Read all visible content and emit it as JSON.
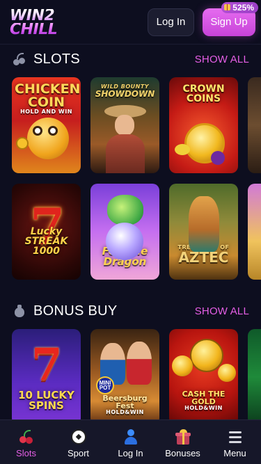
{
  "header": {
    "logo_line1": "WIN2",
    "logo_line2": "CHILL",
    "login_label": "Log In",
    "signup_label": "Sign Up",
    "bonus_badge": "525%"
  },
  "sections": [
    {
      "title": "SLOTS",
      "icon": "cherry-icon",
      "show_all": "SHOW ALL",
      "rows": [
        [
          {
            "title": "CHICKEN COIN",
            "subtitle": "HOLD AND WIN"
          },
          {
            "title": "SHOWDOWN",
            "subtitle": "WILD BOUNTY"
          },
          {
            "title": "CROWN COINS",
            "subtitle": ""
          }
        ],
        [
          {
            "title": "Lucky STREAK 1000",
            "subtitle": ""
          },
          {
            "title": "Fortune Dragon",
            "subtitle": ""
          },
          {
            "title": "AZTEC",
            "subtitle": "TREASURES OF"
          }
        ]
      ]
    },
    {
      "title": "BONUS BUY",
      "icon": "money-bag-icon",
      "show_all": "SHOW ALL",
      "rows": [
        [
          {
            "title": "10 LUCKY SPINS",
            "subtitle": ""
          },
          {
            "title": "Beersburg Fest",
            "subtitle": "HOLD&WIN",
            "badge": "MINI POT"
          },
          {
            "title": "CASH THE GOLD",
            "subtitle": "HOLD&WIN"
          }
        ]
      ]
    }
  ],
  "bottom_nav": [
    {
      "label": "Slots",
      "icon": "cherry-icon",
      "active": true
    },
    {
      "label": "Sport",
      "icon": "soccer-ball-icon",
      "active": false
    },
    {
      "label": "Log In",
      "icon": "user-icon",
      "active": false
    },
    {
      "label": "Bonuses",
      "icon": "gift-icon",
      "active": false
    },
    {
      "label": "Menu",
      "icon": "hamburger-menu-icon",
      "active": false
    }
  ],
  "colors": {
    "background": "#0d0e1f",
    "accent": "#e55fe6",
    "nav_background": "#161729"
  }
}
